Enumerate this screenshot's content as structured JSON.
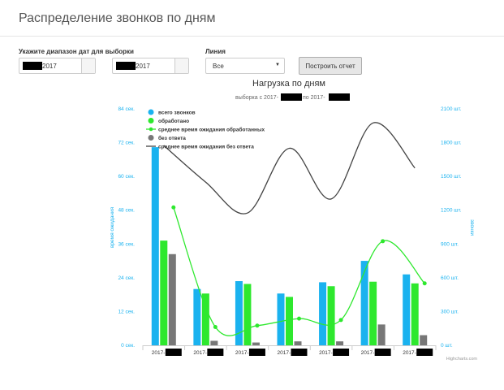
{
  "page": {
    "title": "Распределение звонков по дням"
  },
  "form": {
    "date_range_label": "Укажите диапазон дат для выборки",
    "date_from_suffix": "2017",
    "date_to_suffix": "2017",
    "line_label": "Линия",
    "line_selected": "Все",
    "submit_label": "Построить отчет"
  },
  "chart_data": {
    "type": "bar",
    "title": "Нагрузка по дням",
    "subtitle_prefix": "выборка с 2017-",
    "subtitle_middle": "по 2017-",
    "credits": "Highcharts.com",
    "categories": [
      "2017-",
      "2017-",
      "2017-",
      "2017-",
      "2017-",
      "2017-",
      "2017-"
    ],
    "left_axis": {
      "label": "время ожидания",
      "ylim": [
        0,
        84
      ],
      "ticks": [
        "0 сек.",
        "12 сек.",
        "24 сек.",
        "36 сек.",
        "48 сек.",
        "60 сек.",
        "72 сек.",
        "84 сек."
      ]
    },
    "right_axis": {
      "label": "звонки",
      "ylim": [
        0,
        2100
      ],
      "ticks": [
        "0 шт.",
        "300 шт.",
        "600 шт.",
        "900 шт.",
        "1200 шт.",
        "1500 шт.",
        "1800 шт.",
        "2100 шт."
      ]
    },
    "series": [
      {
        "name": "всего звонков",
        "kind": "bar",
        "axis": "right",
        "color": "#1ab2ef",
        "values": [
          1760,
          500,
          570,
          460,
          560,
          750,
          630
        ]
      },
      {
        "name": "обработано",
        "kind": "bar",
        "axis": "right",
        "color": "#2ee82e",
        "values": [
          930,
          460,
          545,
          430,
          525,
          565,
          550
        ]
      },
      {
        "name": "среднее время ожидания обработанных",
        "kind": "line",
        "axis": "left",
        "color": "#2ee82e",
        "marker": true,
        "values": [
          49,
          6.5,
          7,
          9.5,
          9,
          37,
          22
        ]
      },
      {
        "name": "без ответа",
        "kind": "bar",
        "axis": "right",
        "color": "#777777",
        "values": [
          810,
          40,
          25,
          35,
          35,
          185,
          90
        ]
      },
      {
        "name": "среднее время ожидания без ответа",
        "kind": "line",
        "axis": "left",
        "color": "#444444",
        "marker": false,
        "values": [
          71,
          58,
          47,
          70,
          52,
          79,
          63
        ]
      }
    ]
  }
}
